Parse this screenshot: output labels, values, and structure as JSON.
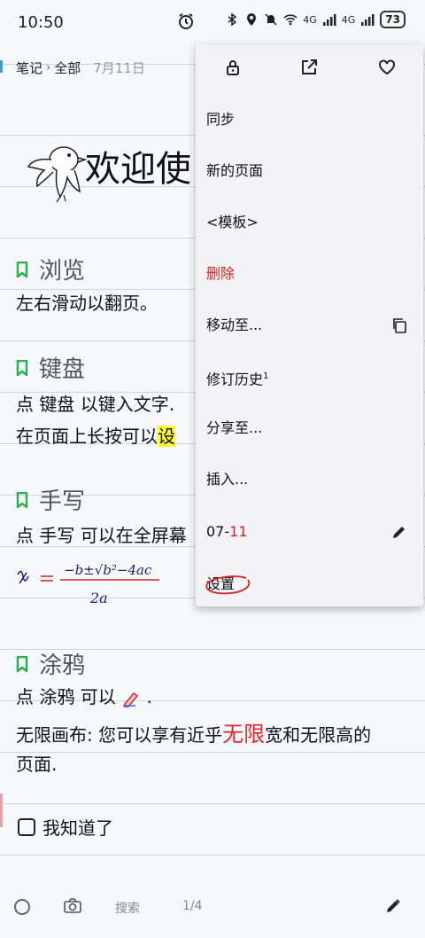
{
  "status_bar": {
    "time": "10:50",
    "network": "4G",
    "network2": "4G",
    "battery": "73"
  },
  "breadcrumb": {
    "root": "笔记",
    "separator": "›",
    "folder": "全部",
    "date": "7月11日"
  },
  "note": {
    "title": "欢迎使",
    "sections": [
      {
        "title": "浏览",
        "lines": [
          "左右滑动以翻页。"
        ]
      },
      {
        "title": "键盘",
        "lines": [
          "点 键盘 以键入文字.",
          "在页面上长按可以",
          "设"
        ]
      },
      {
        "title": "手写",
        "lines": [
          "点 手写 可以在全屏幕"
        ]
      },
      {
        "title": "涂鸦",
        "lines": [
          "点 涂鸦 可以",
          ".",
          "无限画布: 您可以享有近乎",
          "无限",
          "宽和无限高的",
          "页面."
        ]
      }
    ],
    "checkbox_label": "我知道了"
  },
  "toolbar": {
    "search": "搜索",
    "page_indicator": "1/4"
  },
  "menu": {
    "items": [
      {
        "label": "同步"
      },
      {
        "label": "新的页面"
      },
      {
        "label": "<模板>"
      },
      {
        "label": "删除"
      },
      {
        "label": "移动至..."
      },
      {
        "label": "修订历史",
        "sup": "1"
      },
      {
        "label": "分享至..."
      },
      {
        "label": "插入..."
      },
      {
        "label_prefix": "07-",
        "label_suffix": "11"
      },
      {
        "label": "设置"
      }
    ]
  },
  "colors": {
    "accent_green": "#2bb24c",
    "danger_red": "#d42020",
    "highlight_yellow": "#ffff33",
    "ruled_line": "#c9d6ee"
  }
}
